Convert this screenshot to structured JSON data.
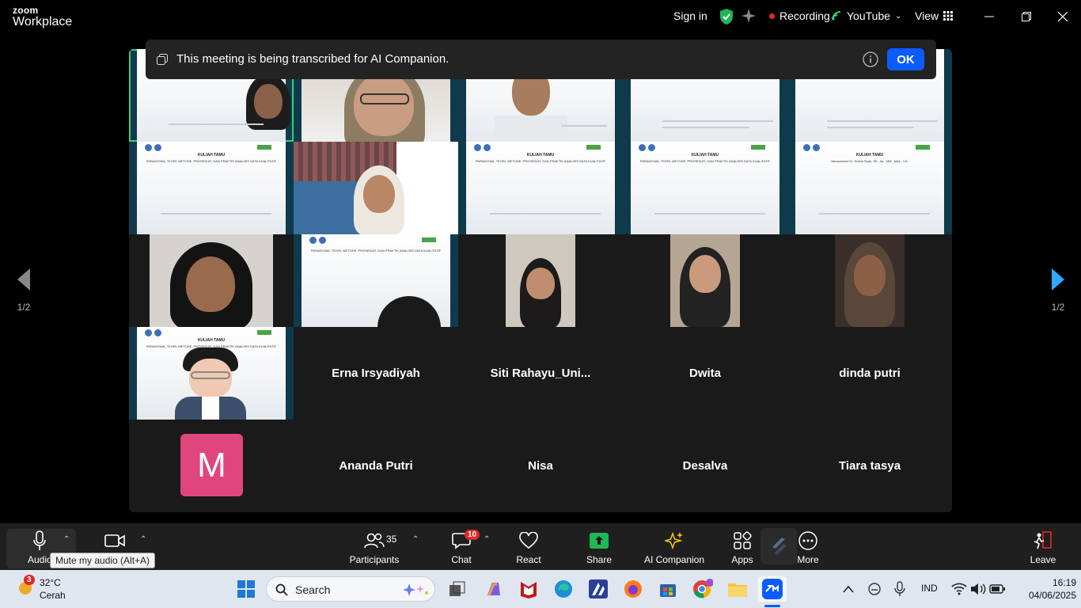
{
  "titlebar": {
    "logo_top": "zoom",
    "logo_bottom": "Workplace",
    "sign_in": "Sign in",
    "recording": "Recording",
    "youtube": "YouTube",
    "view": "View"
  },
  "banner": {
    "message": "This meeting is being transcribed for AI Companion.",
    "ok_label": "OK"
  },
  "gallery": {
    "page_indicator_left": "1/2",
    "page_indicator_right": "1/2",
    "named_tiles": [
      "Erna Irsyadiyah",
      "Siti  Rahayu_Uni...",
      "Dwita",
      "dinda putri",
      "Ananda Putri",
      "Nisa",
      "Desalva",
      "Tiara tasya"
    ],
    "avatar_letter": "M",
    "slide_title": "KULIAH TAMU",
    "slide_subtitle": "PARADIGMA, TEORI, METODE, PROSEDUR, DAN PRAKTIK ANALISIS DATA KUALITATIF",
    "slide_speaker": "Narasumber Dr. Sultan Syah, SE., Ak., MM., MAk., CA."
  },
  "toolbar": {
    "audio_label": "Audio",
    "video_label": "",
    "participants_label": "Participants",
    "participants_count": "35",
    "chat_label": "Chat",
    "chat_badge": "10",
    "react_label": "React",
    "share_label": "Share",
    "ai_label": "AI Companion",
    "apps_label": "Apps",
    "more_label": "More",
    "leave_label": "Leave",
    "tooltip": "Mute my audio (Alt+A)"
  },
  "taskbar": {
    "weather_temp": "32°C",
    "weather_desc": "Cerah",
    "weather_badge": "3",
    "search_placeholder": "Search",
    "lang": "IND",
    "time": "16:19",
    "date": "04/06/2025"
  },
  "colors": {
    "accent_blue": "#0b5cff",
    "active_speaker": "#2bd47a",
    "avatar_pink": "#e0467c",
    "record_red": "#e02828",
    "share_green": "#1db954"
  }
}
